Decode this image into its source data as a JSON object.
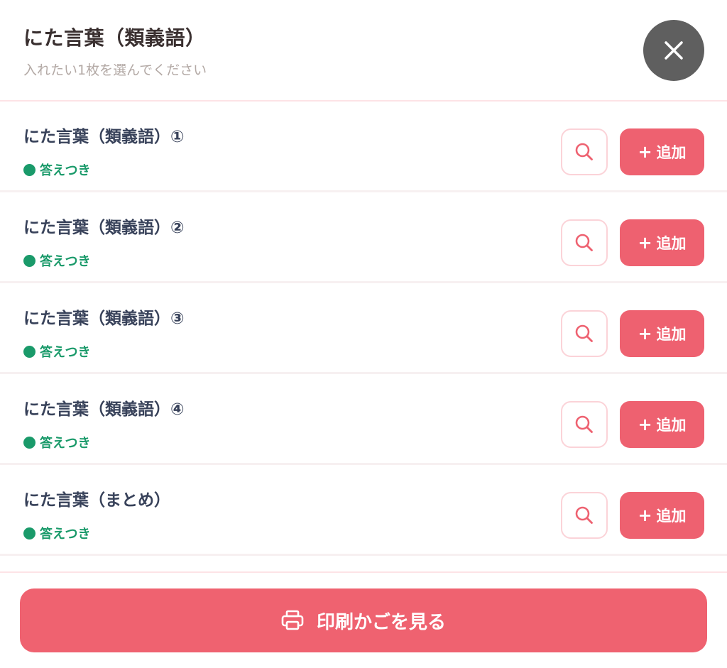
{
  "header": {
    "title": "にた言葉（類義語）",
    "subtitle": "入れたい1枚を選んでください"
  },
  "items": [
    {
      "title": "にた言葉（類義語）①",
      "badge": "答えつき",
      "add_label": "追加"
    },
    {
      "title": "にた言葉（類義語）②",
      "badge": "答えつき",
      "add_label": "追加"
    },
    {
      "title": "にた言葉（類義語）③",
      "badge": "答えつき",
      "add_label": "追加"
    },
    {
      "title": "にた言葉（類義語）④",
      "badge": "答えつき",
      "add_label": "追加"
    },
    {
      "title": "にた言葉（まとめ）",
      "badge": "答えつき",
      "add_label": "追加"
    }
  ],
  "footer": {
    "cart_label": "印刷かごを見る"
  },
  "colors": {
    "accent": "#ee6170",
    "badge_green": "#1a9a6a",
    "close_bg": "#5f5f5f"
  },
  "icons": {
    "close": "close-icon",
    "preview": "search-icon",
    "add": "plus-icon",
    "cart": "printer-icon"
  }
}
